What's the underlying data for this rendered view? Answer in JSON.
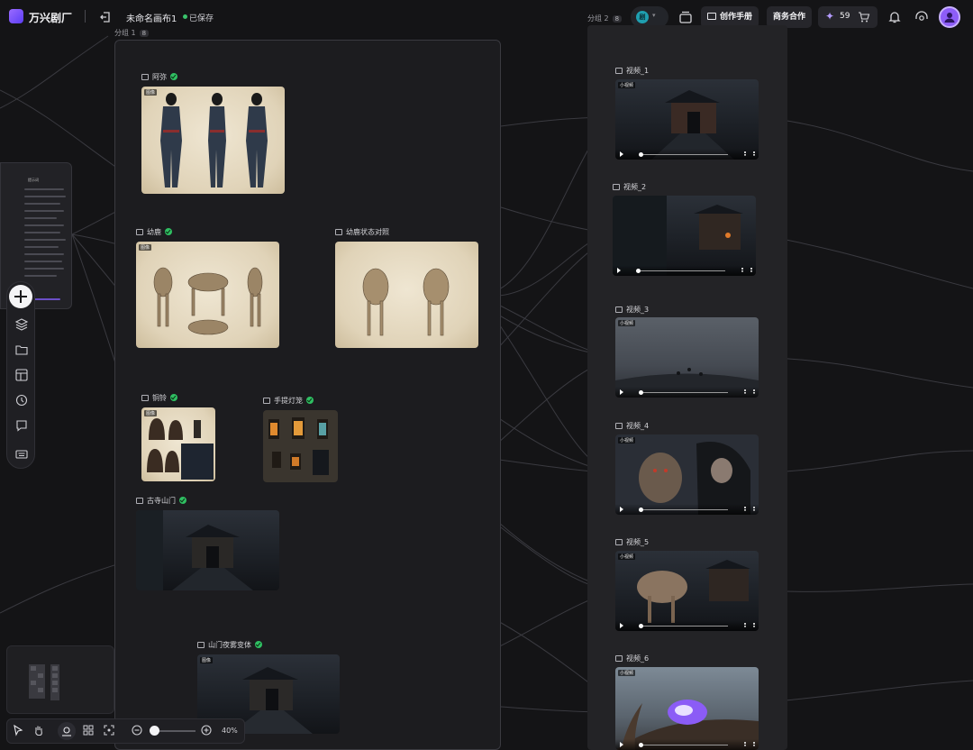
{
  "app": {
    "name": "万兴剧厂",
    "canvas_title": "未命名画布1",
    "save_status": "已保存"
  },
  "toolbar_top": {
    "workspace_initial": "剧",
    "manual_label": "创作手册",
    "business_label": "商务合作",
    "credits": "59"
  },
  "groups": {
    "group1": {
      "label": "分组 1",
      "count": "8"
    },
    "group2": {
      "label": "分组 2",
      "count": "8"
    }
  },
  "image_nodes": [
    {
      "title": "阿弥",
      "tag": "图像"
    },
    {
      "title": "幼鹿",
      "tag": "图像"
    },
    {
      "title": "幼鹿状态对照",
      "tag": ""
    },
    {
      "title": "铜铃",
      "tag": "图像"
    },
    {
      "title": "手提灯笼",
      "tag": ""
    },
    {
      "title": "古寺山门",
      "tag": "图像"
    },
    {
      "title": "山门夜雾变体",
      "tag": "图像"
    }
  ],
  "video_nodes": [
    {
      "title": "视频_1",
      "tag": "小视频"
    },
    {
      "title": "视频_2",
      "tag": ""
    },
    {
      "title": "视频_3",
      "tag": "小视频"
    },
    {
      "title": "视频_4",
      "tag": "小视频"
    },
    {
      "title": "视频_5",
      "tag": "小视频"
    },
    {
      "title": "视频_6",
      "tag": "小视频"
    }
  ],
  "left_panel": {
    "heading": "提示词"
  },
  "left_toolbar": {
    "icons": [
      "plus-icon",
      "layers-icon",
      "folder-icon",
      "template-icon",
      "history-icon",
      "chat-icon",
      "keyboard-icon"
    ]
  },
  "bottom_bar": {
    "icons": [
      "select-arrow-icon",
      "hand-icon",
      "locate-icon",
      "grid-icon",
      "fit-icon",
      "zoom-out-icon",
      "zoom-in-icon"
    ],
    "zoom": "40%"
  },
  "colors": {
    "accent": "#8d5df7",
    "success": "#2fbf62",
    "background": "#141416"
  }
}
